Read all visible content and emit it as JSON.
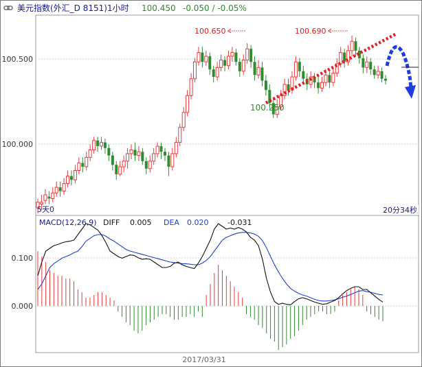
{
  "header": {
    "icon": "link-icon",
    "title": "美元指数(外汇_D 8151)1小时",
    "last": "100.450",
    "change": "-0.050 / -0.05%"
  },
  "price_panel": {
    "yticks": [
      "100.500",
      "100.000"
    ],
    "left_note": "5天0",
    "right_note": "20分34秒",
    "annotations": [
      {
        "label": "100.650",
        "value": 100.65
      },
      {
        "label": "100.690",
        "value": 100.69
      },
      {
        "label": "100.250",
        "value": 100.25
      }
    ],
    "trendline": [
      [
        15.0,
        100.25
      ],
      [
        35.5,
        100.65
      ]
    ],
    "projection_arrow": "blue-dashed-down-arrow",
    "last_price_marker": 100.45
  },
  "macd_panel": {
    "label": "MACD(12,26,9)",
    "diff_label": "DIFF",
    "diff_value": "0.005",
    "dea_label": "DEA",
    "dea_value": "0.020",
    "macd_value": "-0.031",
    "yticks": [
      "0.100",
      "0.000"
    ]
  },
  "x_axis": {
    "date_label": "2017/03/31"
  },
  "colors": {
    "up": "#e8383b",
    "down": "#2e8b2e",
    "diff_line": "#111111",
    "dea_line": "#1f3fd0",
    "trendline": "#e02020",
    "arrow": "#1e3fe0",
    "header_value": "#2e8b2e",
    "header_text": "#1a1a8c",
    "macd_label_blue": "#1a1a8c",
    "annotation": "#d42020",
    "annotation_low": "#2e8b2e"
  },
  "chart_data": [
    {
      "type": "candlestick",
      "title": "美元指数(外汇_D 8151)1小时",
      "ylim": [
        99.73,
        100.8
      ],
      "yticks": [
        100.5,
        100.0
      ],
      "candles": [
        [
          99.77,
          99.8,
          99.74,
          99.82
        ],
        [
          99.79,
          99.8,
          99.76,
          99.84
        ],
        [
          99.81,
          99.84,
          99.79,
          99.87
        ],
        [
          99.83,
          99.82,
          99.79,
          99.86
        ],
        [
          99.82,
          99.85,
          99.8,
          99.88
        ],
        [
          99.85,
          99.88,
          99.83,
          99.91
        ],
        [
          99.88,
          99.86,
          99.83,
          99.91
        ],
        [
          99.86,
          99.9,
          99.84,
          99.93
        ],
        [
          99.9,
          99.94,
          99.88,
          99.97
        ],
        [
          99.94,
          99.92,
          99.89,
          99.97
        ],
        [
          99.92,
          99.97,
          99.9,
          100.0
        ],
        [
          99.97,
          100.01,
          99.95,
          100.04
        ],
        [
          100.01,
          99.99,
          99.96,
          100.04
        ],
        [
          99.99,
          100.04,
          99.97,
          100.07
        ],
        [
          100.04,
          100.08,
          100.02,
          100.11
        ],
        [
          100.08,
          100.13,
          100.06,
          100.15
        ],
        [
          100.13,
          100.1,
          100.07,
          100.15
        ],
        [
          100.1,
          100.12,
          100.08,
          100.15
        ],
        [
          100.12,
          100.09,
          100.06,
          100.14
        ],
        [
          100.09,
          100.05,
          100.02,
          100.11
        ],
        [
          100.05,
          100.0,
          99.97,
          100.07
        ],
        [
          100.0,
          99.95,
          99.92,
          100.02
        ],
        [
          99.95,
          99.99,
          99.94,
          100.02
        ],
        [
          99.99,
          100.02,
          99.96,
          100.05
        ],
        [
          100.02,
          100.06,
          99.98,
          100.09
        ],
        [
          100.06,
          100.08,
          100.03,
          100.11
        ],
        [
          100.08,
          100.05,
          100.02,
          100.12
        ],
        [
          100.05,
          100.07,
          100.02,
          100.1
        ],
        [
          100.07,
          100.02,
          100.0,
          100.09
        ],
        [
          100.02,
          99.98,
          99.95,
          100.04
        ],
        [
          99.98,
          100.02,
          99.96,
          100.05
        ],
        [
          100.02,
          100.06,
          100.0,
          100.09
        ],
        [
          100.06,
          100.1,
          100.04,
          100.12
        ],
        [
          100.1,
          100.07,
          100.03,
          100.12
        ],
        [
          100.07,
          100.05,
          100.02,
          100.09
        ],
        [
          100.05,
          99.99,
          99.94,
          100.07
        ],
        [
          99.99,
          100.06,
          99.97,
          100.09
        ],
        [
          100.06,
          100.12,
          100.04,
          100.15
        ],
        [
          100.12,
          100.2,
          100.1,
          100.22
        ],
        [
          100.2,
          100.28,
          100.18,
          100.31
        ],
        [
          100.28,
          100.37,
          100.26,
          100.4
        ],
        [
          100.37,
          100.46,
          100.35,
          100.49
        ],
        [
          100.46,
          100.55,
          100.44,
          100.57
        ],
        [
          100.55,
          100.6,
          100.53,
          100.63
        ],
        [
          100.6,
          100.55,
          100.52,
          100.63
        ],
        [
          100.55,
          100.58,
          100.53,
          100.61
        ],
        [
          100.58,
          100.51,
          100.48,
          100.6
        ],
        [
          100.51,
          100.47,
          100.44,
          100.53
        ],
        [
          100.47,
          100.52,
          100.45,
          100.55
        ],
        [
          100.52,
          100.56,
          100.5,
          100.59
        ],
        [
          100.56,
          100.53,
          100.5,
          100.58
        ],
        [
          100.53,
          100.58,
          100.51,
          100.61
        ],
        [
          100.58,
          100.6,
          100.55,
          100.63
        ],
        [
          100.6,
          100.55,
          100.53,
          100.62
        ],
        [
          100.55,
          100.5,
          100.47,
          100.57
        ],
        [
          100.5,
          100.56,
          100.48,
          100.59
        ],
        [
          100.56,
          100.62,
          100.54,
          100.65
        ],
        [
          100.62,
          100.55,
          100.52,
          100.64
        ],
        [
          100.55,
          100.48,
          100.45,
          100.58
        ],
        [
          100.48,
          100.52,
          100.46,
          100.56
        ],
        [
          100.52,
          100.45,
          100.42,
          100.55
        ],
        [
          100.45,
          100.4,
          100.37,
          100.48
        ],
        [
          100.4,
          100.33,
          100.3,
          100.43
        ],
        [
          100.33,
          100.27,
          100.25,
          100.36
        ],
        [
          100.27,
          100.31,
          100.25,
          100.35
        ],
        [
          100.31,
          100.37,
          100.29,
          100.4
        ],
        [
          100.37,
          100.43,
          100.35,
          100.46
        ],
        [
          100.43,
          100.4,
          100.37,
          100.46
        ],
        [
          100.4,
          100.47,
          100.38,
          100.5
        ],
        [
          100.47,
          100.55,
          100.45,
          100.58
        ],
        [
          100.55,
          100.5,
          100.47,
          100.57
        ],
        [
          100.5,
          100.46,
          100.43,
          100.53
        ],
        [
          100.46,
          100.43,
          100.4,
          100.49
        ],
        [
          100.43,
          100.47,
          100.41,
          100.5
        ],
        [
          100.47,
          100.44,
          100.41,
          100.49
        ],
        [
          100.44,
          100.41,
          100.38,
          100.47
        ],
        [
          100.41,
          100.44,
          100.39,
          100.47
        ],
        [
          100.44,
          100.48,
          100.42,
          100.51
        ],
        [
          100.48,
          100.44,
          100.41,
          100.5
        ],
        [
          100.44,
          100.49,
          100.42,
          100.52
        ],
        [
          100.49,
          100.54,
          100.47,
          100.57
        ],
        [
          100.54,
          100.6,
          100.52,
          100.63
        ],
        [
          100.6,
          100.55,
          100.52,
          100.62
        ],
        [
          100.55,
          100.61,
          100.53,
          100.64
        ],
        [
          100.61,
          100.66,
          100.58,
          100.69
        ],
        [
          100.66,
          100.61,
          100.58,
          100.68
        ],
        [
          100.61,
          100.57,
          100.54,
          100.63
        ],
        [
          100.57,
          100.52,
          100.49,
          100.59
        ],
        [
          100.52,
          100.55,
          100.49,
          100.58
        ],
        [
          100.55,
          100.51,
          100.48,
          100.57
        ],
        [
          100.51,
          100.48,
          100.46,
          100.53
        ],
        [
          100.48,
          100.5,
          100.46,
          100.53
        ],
        [
          100.5,
          100.46,
          100.44,
          100.52
        ],
        [
          100.46,
          100.45,
          100.43,
          100.48
        ]
      ]
    },
    {
      "type": "line",
      "title": "MACD(12,26,9)",
      "ylim": [
        -0.085,
        0.165
      ],
      "yticks": [
        0.1,
        0.0
      ],
      "series": [
        {
          "name": "DIFF",
          "values": [
            0.055,
            0.08,
            0.1,
            0.105,
            0.11,
            0.112,
            0.115,
            0.117,
            0.118,
            0.12,
            0.13,
            0.14,
            0.15,
            0.148,
            0.143,
            0.138,
            0.128,
            0.115,
            0.1,
            0.095,
            0.09,
            0.087,
            0.09,
            0.093,
            0.092,
            0.088,
            0.085,
            0.086,
            0.085,
            0.08,
            0.075,
            0.07,
            0.07,
            0.072,
            0.078,
            0.08,
            0.075,
            0.072,
            0.07,
            0.068,
            0.078,
            0.09,
            0.105,
            0.12,
            0.14,
            0.15,
            0.145,
            0.14,
            0.142,
            0.14,
            0.143,
            0.14,
            0.135,
            0.125,
            0.12,
            0.11,
            0.085,
            0.05,
            0.025,
            0.008,
            0.003,
            0.005,
            0.003,
            0.002,
            0.008,
            0.013,
            0.015,
            0.013,
            0.01,
            0.007,
            0.005,
            0.003,
            0.004,
            0.007,
            0.01,
            0.015,
            0.022,
            0.028,
            0.032,
            0.035,
            0.035,
            0.03,
            0.03,
            0.024,
            0.018,
            0.012,
            0.007
          ]
        },
        {
          "name": "DEA",
          "values": [
            0.03,
            0.04,
            0.055,
            0.07,
            0.077,
            0.082,
            0.087,
            0.09,
            0.093,
            0.097,
            0.1,
            0.108,
            0.118,
            0.123,
            0.128,
            0.13,
            0.13,
            0.127,
            0.122,
            0.118,
            0.113,
            0.108,
            0.103,
            0.1,
            0.098,
            0.096,
            0.094,
            0.092,
            0.09,
            0.088,
            0.086,
            0.084,
            0.082,
            0.08,
            0.079,
            0.078,
            0.077,
            0.077,
            0.076,
            0.075,
            0.075,
            0.078,
            0.083,
            0.09,
            0.1,
            0.11,
            0.12,
            0.125,
            0.128,
            0.131,
            0.133,
            0.134,
            0.134,
            0.133,
            0.131,
            0.127,
            0.119,
            0.106,
            0.09,
            0.075,
            0.062,
            0.05,
            0.04,
            0.032,
            0.027,
            0.023,
            0.02,
            0.018,
            0.015,
            0.012,
            0.01,
            0.009,
            0.009,
            0.01,
            0.011,
            0.013,
            0.016,
            0.018,
            0.021,
            0.024,
            0.027,
            0.028,
            0.026,
            0.025,
            0.023,
            0.021,
            0.02
          ]
        },
        {
          "name": "MACD",
          "values": [
            0.1,
            0.09,
            0.08,
            0.065,
            0.06,
            0.055,
            0.055,
            0.05,
            0.05,
            0.045,
            0.03,
            0.025,
            0.015,
            0.015,
            0.02,
            0.025,
            0.025,
            0.02,
            0.015,
            0.01,
            -0.01,
            -0.02,
            -0.03,
            -0.035,
            -0.045,
            -0.05,
            -0.045,
            -0.035,
            -0.03,
            -0.025,
            -0.02,
            -0.015,
            -0.015,
            -0.02,
            -0.025,
            -0.025,
            -0.02,
            -0.02,
            -0.015,
            -0.02,
            -0.01,
            -0.02,
            0.02,
            0.04,
            0.06,
            0.075,
            0.065,
            0.055,
            0.045,
            0.035,
            0.025,
            0.015,
            -0.015,
            -0.02,
            -0.025,
            -0.035,
            -0.04,
            -0.05,
            -0.06,
            -0.065,
            -0.08,
            -0.075,
            -0.07,
            -0.06,
            -0.055,
            -0.045,
            -0.035,
            -0.025,
            -0.02,
            -0.015,
            -0.01,
            -0.01,
            -0.015,
            -0.015,
            -0.01,
            0.01,
            0.02,
            0.025,
            0.03,
            0.035,
            0.03,
            0.02,
            -0.01,
            -0.015,
            -0.02,
            -0.025,
            -0.028
          ]
        }
      ]
    }
  ]
}
